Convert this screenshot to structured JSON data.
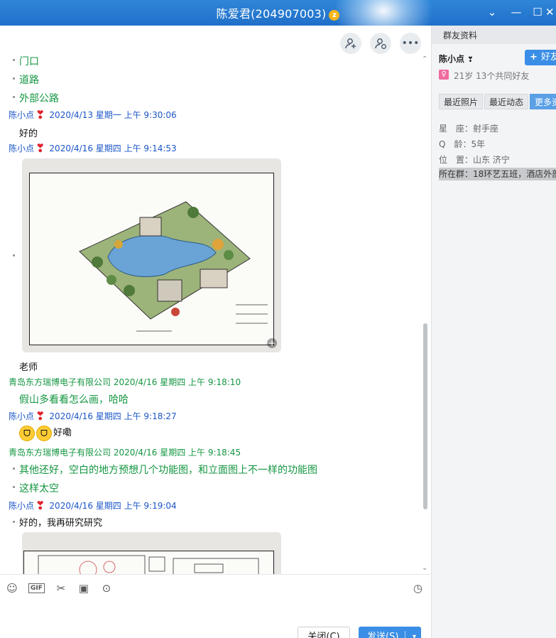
{
  "window": {
    "title": "陈爱君(204907003)",
    "vip_badge": "z"
  },
  "chat_tools": [
    {
      "name": "invite-member-icon"
    },
    {
      "name": "add-contact-icon"
    },
    {
      "name": "more-icon"
    }
  ],
  "messages": {
    "top_partial": "门口",
    "item_road": "道路",
    "item_outer_road": "外部公路",
    "m1_sender": "陈小点",
    "m1_time": "2020/4/13 星期一 上午 9:30:06",
    "m1_text": "好的",
    "m2_sender": "陈小点",
    "m2_time": "2020/4/16 星期四 上午 9:14:53",
    "m2_caption": "老师",
    "m3_sender": "青岛东方瑞博电子有限公司",
    "m3_time": "2020/4/16 星期四 上午 9:18:10",
    "m3_text": "假山多看看怎么画，哈哈",
    "m4_sender": "陈小点",
    "m4_time": "2020/4/16 星期四 上午 9:18:27",
    "m4_text": "好嘞",
    "m5_sender": "青岛东方瑞博电子有限公司",
    "m5_time": "2020/4/16 星期四 上午 9:18:45",
    "m5_line1": "其他还好，空白的地方预想几个功能图，和立面图上不一样的功能图",
    "m5_line2": "这样太空",
    "m6_sender": "陈小点",
    "m6_time": "2020/4/16 星期四 上午 9:19:04",
    "m6_text": "好的，我再研究研究"
  },
  "input": {
    "toolbar": [
      {
        "name": "emoji-icon",
        "glyph": "☺"
      },
      {
        "name": "gif-icon",
        "glyph": "GIF"
      },
      {
        "name": "scissors-icon",
        "glyph": "✂"
      },
      {
        "name": "image-icon",
        "glyph": "▣"
      },
      {
        "name": "more-tools-icon",
        "glyph": "⊙"
      }
    ],
    "close_label": "关闭(C)",
    "send_label": "发送(S)"
  },
  "side": {
    "header": "群友资料",
    "name": "陈小点",
    "add_friend": "好友",
    "sub": "21岁 13个共同好友",
    "tabs": [
      "最近照片",
      "最近动态",
      "更多资料"
    ],
    "zodiac": "星　座：射手座",
    "qage": "Q　龄：5年",
    "location": "位　置：山东 济宁",
    "groups": "所在群：18环艺五班，酒店外部"
  },
  "colors": {
    "title_bar": "#1f6fc9",
    "accent": "#3a8ee6",
    "green_text": "#159642",
    "user_blue": "#1b56c7"
  }
}
